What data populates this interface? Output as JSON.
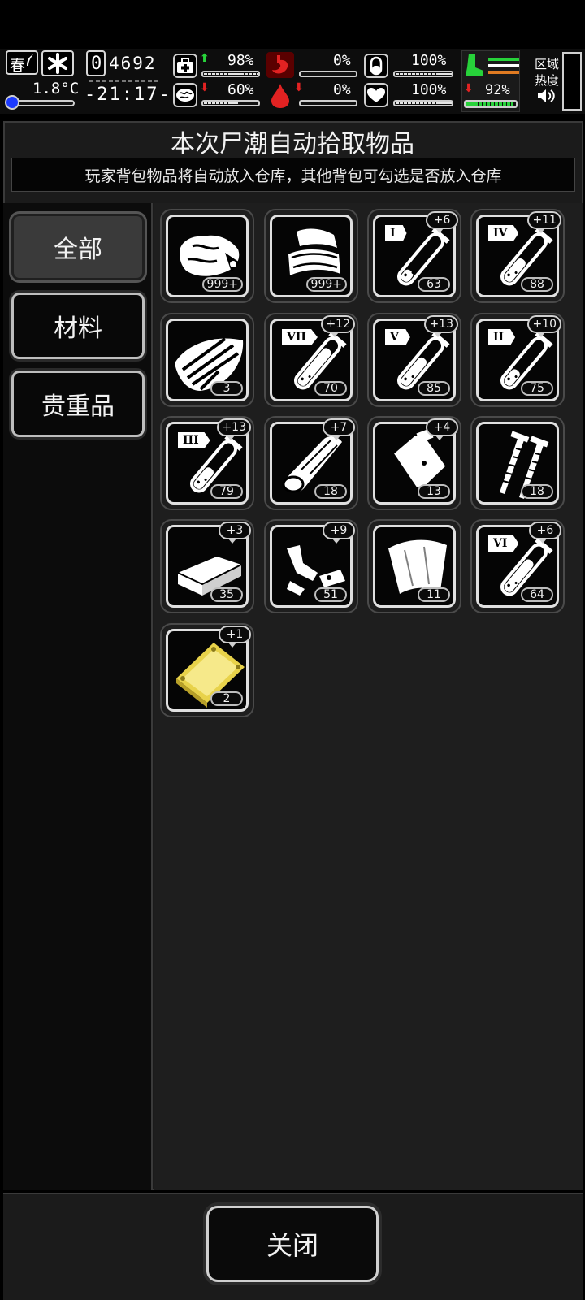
{
  "hud": {
    "season": "春",
    "temperature": "1.8°C",
    "counter": "4692",
    "clock": "-21:17-",
    "stats": [
      {
        "name": "health",
        "value": "98%",
        "trend": "up",
        "fill": 0.98
      },
      {
        "name": "hunger",
        "value": "0%",
        "trend": "none",
        "fill": 0.0
      },
      {
        "name": "pills",
        "value": "100%",
        "trend": "none",
        "fill": 1.0
      },
      {
        "name": "brain",
        "value": "60%",
        "trend": "down",
        "fill": 0.6
      },
      {
        "name": "blood",
        "value": "0%",
        "trend": "down",
        "fill": 0.0
      },
      {
        "name": "heart",
        "value": "100%",
        "trend": "none",
        "fill": 1.0
      },
      {
        "name": "stamina",
        "value": "92%",
        "trend": "down",
        "fill": 0.92
      }
    ],
    "zone_label_1": "区域",
    "zone_label_2": "热度",
    "colors": {
      "green": "#27d23a",
      "orange": "#e07b22",
      "red": "#e22222"
    }
  },
  "panel": {
    "title": "本次尸潮自动拾取物品",
    "subtitle": "玩家背包物品将自动放入仓库，其他背包可勾选是否放入仓库"
  },
  "tabs": [
    {
      "label": "全部",
      "active": true
    },
    {
      "label": "材料",
      "active": false
    },
    {
      "label": "贵重品",
      "active": false
    }
  ],
  "items": [
    {
      "icon": "meat-icon",
      "count": "999+",
      "bonus": ""
    },
    {
      "icon": "cloth-icon",
      "count": "999+",
      "bonus": ""
    },
    {
      "icon": "test-tube-icon",
      "roman": "I",
      "count": "63",
      "bonus": "+6",
      "level": 0.2
    },
    {
      "icon": "test-tube-icon",
      "roman": "IV",
      "count": "88",
      "bonus": "+11",
      "level": 0.45
    },
    {
      "icon": "leather-icon",
      "count": "3",
      "bonus": ""
    },
    {
      "icon": "test-tube-icon",
      "roman": "VII",
      "count": "70",
      "bonus": "+12",
      "level": 0.75
    },
    {
      "icon": "test-tube-icon",
      "roman": "V",
      "count": "85",
      "bonus": "+13",
      "level": 0.55
    },
    {
      "icon": "test-tube-icon",
      "roman": "II",
      "count": "75",
      "bonus": "+10",
      "level": 0.3
    },
    {
      "icon": "test-tube-icon",
      "roman": "III",
      "count": "79",
      "bonus": "+13",
      "level": 0.4
    },
    {
      "icon": "bandage-roll-icon",
      "count": "18",
      "bonus": "+7"
    },
    {
      "icon": "tape-icon",
      "count": "13",
      "bonus": "+4"
    },
    {
      "icon": "screws-icon",
      "count": "18",
      "bonus": ""
    },
    {
      "icon": "brick-icon",
      "count": "35",
      "bonus": "+3"
    },
    {
      "icon": "scrap-parts-icon",
      "count": "51",
      "bonus": "+9"
    },
    {
      "icon": "glass-shard-icon",
      "count": "11",
      "bonus": ""
    },
    {
      "icon": "test-tube-icon",
      "roman": "VI",
      "count": "64",
      "bonus": "+6",
      "level": 0.65
    },
    {
      "icon": "gold-plate-icon",
      "count": "2",
      "bonus": "+1"
    }
  ],
  "footer": {
    "close_label": "关闭"
  }
}
